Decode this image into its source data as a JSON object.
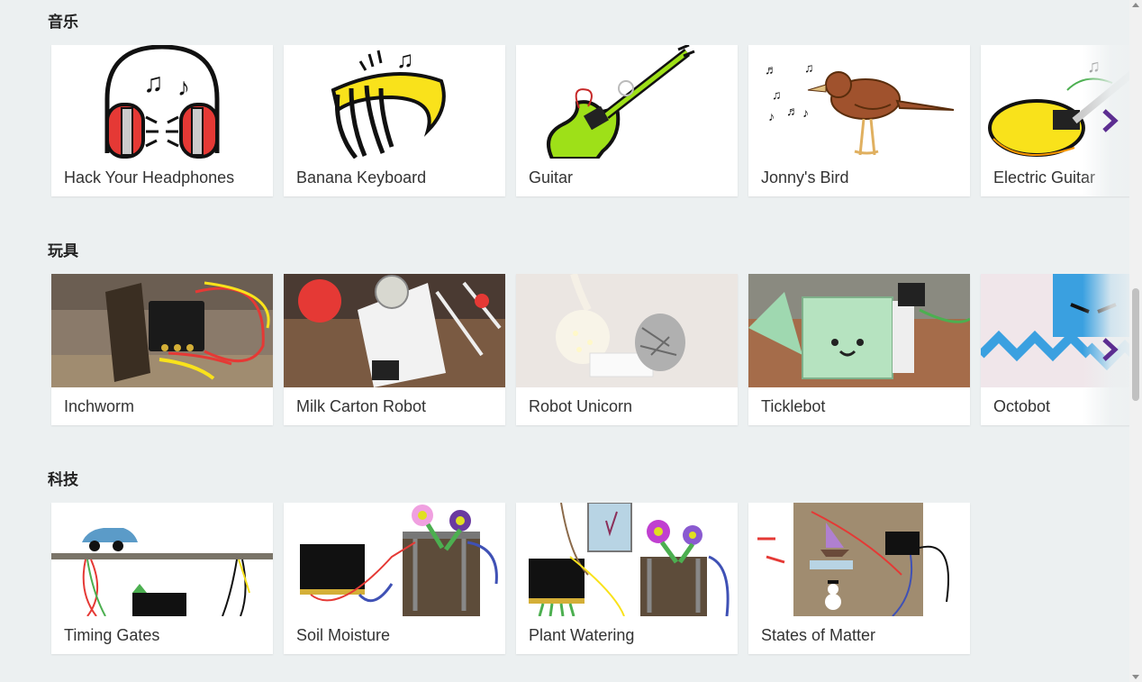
{
  "sections": [
    {
      "title": "音乐",
      "cards": [
        {
          "label": "Hack Your Headphones",
          "image": "headphones-drawing"
        },
        {
          "label": "Banana Keyboard",
          "image": "banana-hand-drawing"
        },
        {
          "label": "Guitar",
          "image": "green-guitar-drawing"
        },
        {
          "label": "Jonny's Bird",
          "image": "bird-drawing"
        },
        {
          "label": "Electric Guitar",
          "image": "electric-guitar-drawing"
        }
      ],
      "has_next_arrow": true
    },
    {
      "title": "玩具",
      "cards": [
        {
          "label": "Inchworm",
          "image": "inchworm-photo"
        },
        {
          "label": "Milk Carton Robot",
          "image": "milk-carton-robot-photo"
        },
        {
          "label": "Robot Unicorn",
          "image": "robot-unicorn-photo"
        },
        {
          "label": "Ticklebot",
          "image": "ticklebot-photo"
        },
        {
          "label": "Octobot",
          "image": "octobot-photo"
        }
      ],
      "has_next_arrow": true
    },
    {
      "title": "科技",
      "cards": [
        {
          "label": "Timing Gates",
          "image": "timing-gates-drawing"
        },
        {
          "label": "Soil Moisture",
          "image": "soil-moisture-drawing"
        },
        {
          "label": "Plant Watering",
          "image": "plant-watering-drawing"
        },
        {
          "label": "States of Matter",
          "image": "states-of-matter-drawing"
        }
      ],
      "has_next_arrow": false
    }
  ],
  "colors": {
    "background": "#ecf0f1",
    "card": "#ffffff",
    "chevron": "#5c2d91"
  }
}
